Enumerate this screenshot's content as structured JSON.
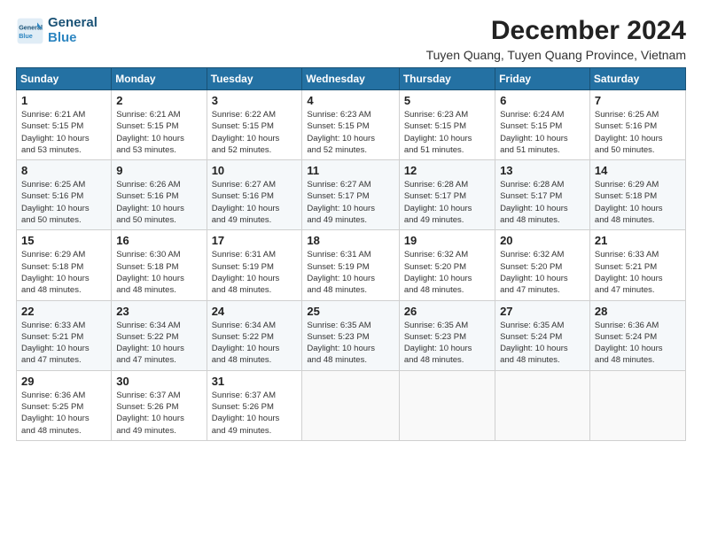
{
  "header": {
    "logo_line1": "General",
    "logo_line2": "Blue",
    "month_title": "December 2024",
    "subtitle": "Tuyen Quang, Tuyen Quang Province, Vietnam"
  },
  "weekdays": [
    "Sunday",
    "Monday",
    "Tuesday",
    "Wednesday",
    "Thursday",
    "Friday",
    "Saturday"
  ],
  "weeks": [
    [
      {
        "day": "1",
        "info": "Sunrise: 6:21 AM\nSunset: 5:15 PM\nDaylight: 10 hours\nand 53 minutes."
      },
      {
        "day": "2",
        "info": "Sunrise: 6:21 AM\nSunset: 5:15 PM\nDaylight: 10 hours\nand 53 minutes."
      },
      {
        "day": "3",
        "info": "Sunrise: 6:22 AM\nSunset: 5:15 PM\nDaylight: 10 hours\nand 52 minutes."
      },
      {
        "day": "4",
        "info": "Sunrise: 6:23 AM\nSunset: 5:15 PM\nDaylight: 10 hours\nand 52 minutes."
      },
      {
        "day": "5",
        "info": "Sunrise: 6:23 AM\nSunset: 5:15 PM\nDaylight: 10 hours\nand 51 minutes."
      },
      {
        "day": "6",
        "info": "Sunrise: 6:24 AM\nSunset: 5:15 PM\nDaylight: 10 hours\nand 51 minutes."
      },
      {
        "day": "7",
        "info": "Sunrise: 6:25 AM\nSunset: 5:16 PM\nDaylight: 10 hours\nand 50 minutes."
      }
    ],
    [
      {
        "day": "8",
        "info": "Sunrise: 6:25 AM\nSunset: 5:16 PM\nDaylight: 10 hours\nand 50 minutes."
      },
      {
        "day": "9",
        "info": "Sunrise: 6:26 AM\nSunset: 5:16 PM\nDaylight: 10 hours\nand 50 minutes."
      },
      {
        "day": "10",
        "info": "Sunrise: 6:27 AM\nSunset: 5:16 PM\nDaylight: 10 hours\nand 49 minutes."
      },
      {
        "day": "11",
        "info": "Sunrise: 6:27 AM\nSunset: 5:17 PM\nDaylight: 10 hours\nand 49 minutes."
      },
      {
        "day": "12",
        "info": "Sunrise: 6:28 AM\nSunset: 5:17 PM\nDaylight: 10 hours\nand 49 minutes."
      },
      {
        "day": "13",
        "info": "Sunrise: 6:28 AM\nSunset: 5:17 PM\nDaylight: 10 hours\nand 48 minutes."
      },
      {
        "day": "14",
        "info": "Sunrise: 6:29 AM\nSunset: 5:18 PM\nDaylight: 10 hours\nand 48 minutes."
      }
    ],
    [
      {
        "day": "15",
        "info": "Sunrise: 6:29 AM\nSunset: 5:18 PM\nDaylight: 10 hours\nand 48 minutes."
      },
      {
        "day": "16",
        "info": "Sunrise: 6:30 AM\nSunset: 5:18 PM\nDaylight: 10 hours\nand 48 minutes."
      },
      {
        "day": "17",
        "info": "Sunrise: 6:31 AM\nSunset: 5:19 PM\nDaylight: 10 hours\nand 48 minutes."
      },
      {
        "day": "18",
        "info": "Sunrise: 6:31 AM\nSunset: 5:19 PM\nDaylight: 10 hours\nand 48 minutes."
      },
      {
        "day": "19",
        "info": "Sunrise: 6:32 AM\nSunset: 5:20 PM\nDaylight: 10 hours\nand 48 minutes."
      },
      {
        "day": "20",
        "info": "Sunrise: 6:32 AM\nSunset: 5:20 PM\nDaylight: 10 hours\nand 47 minutes."
      },
      {
        "day": "21",
        "info": "Sunrise: 6:33 AM\nSunset: 5:21 PM\nDaylight: 10 hours\nand 47 minutes."
      }
    ],
    [
      {
        "day": "22",
        "info": "Sunrise: 6:33 AM\nSunset: 5:21 PM\nDaylight: 10 hours\nand 47 minutes."
      },
      {
        "day": "23",
        "info": "Sunrise: 6:34 AM\nSunset: 5:22 PM\nDaylight: 10 hours\nand 47 minutes."
      },
      {
        "day": "24",
        "info": "Sunrise: 6:34 AM\nSunset: 5:22 PM\nDaylight: 10 hours\nand 48 minutes."
      },
      {
        "day": "25",
        "info": "Sunrise: 6:35 AM\nSunset: 5:23 PM\nDaylight: 10 hours\nand 48 minutes."
      },
      {
        "day": "26",
        "info": "Sunrise: 6:35 AM\nSunset: 5:23 PM\nDaylight: 10 hours\nand 48 minutes."
      },
      {
        "day": "27",
        "info": "Sunrise: 6:35 AM\nSunset: 5:24 PM\nDaylight: 10 hours\nand 48 minutes."
      },
      {
        "day": "28",
        "info": "Sunrise: 6:36 AM\nSunset: 5:24 PM\nDaylight: 10 hours\nand 48 minutes."
      }
    ],
    [
      {
        "day": "29",
        "info": "Sunrise: 6:36 AM\nSunset: 5:25 PM\nDaylight: 10 hours\nand 48 minutes."
      },
      {
        "day": "30",
        "info": "Sunrise: 6:37 AM\nSunset: 5:26 PM\nDaylight: 10 hours\nand 49 minutes."
      },
      {
        "day": "31",
        "info": "Sunrise: 6:37 AM\nSunset: 5:26 PM\nDaylight: 10 hours\nand 49 minutes."
      },
      null,
      null,
      null,
      null
    ]
  ]
}
